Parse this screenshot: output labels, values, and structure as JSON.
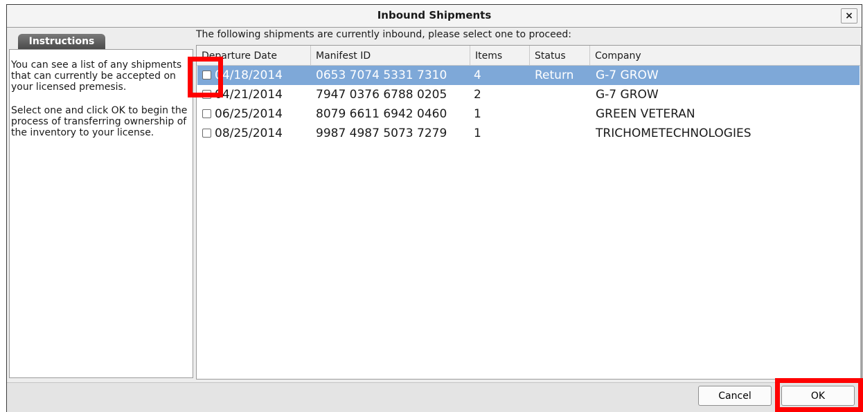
{
  "dialog": {
    "title": "Inbound Shipments",
    "close_label": "×"
  },
  "instructions": {
    "tab_label": "Instructions",
    "para1": "You can see a list of any shipments that can currently be accepted on your licensed premesis.",
    "para2": "Select one and click OK to begin the process of transferring ownership of the inventory to your license."
  },
  "message": "The following shipments are currently inbound, please select one to proceed:",
  "table": {
    "columns": [
      "Departure Date",
      "Manifest ID",
      "Items",
      "Status",
      "Company"
    ],
    "rows": [
      {
        "date": "04/18/2014",
        "manifest": "0653 7074 5331 7310",
        "items": "4",
        "status": "Return",
        "company": "G-7 GROW",
        "selected": true,
        "checked": false
      },
      {
        "date": "04/21/2014",
        "manifest": "7947 0376 6788 0205",
        "items": "2",
        "status": "",
        "company": "G-7 GROW",
        "selected": false,
        "checked": false
      },
      {
        "date": "06/25/2014",
        "manifest": "8079 6611 6942 0460",
        "items": "1",
        "status": "",
        "company": "GREEN VETERAN",
        "selected": false,
        "checked": false
      },
      {
        "date": "08/25/2014",
        "manifest": "9987 4987 5073 7279",
        "items": "1",
        "status": "",
        "company": "TRICHOMETECHNOLOGIES",
        "selected": false,
        "checked": false
      }
    ]
  },
  "buttons": {
    "cancel": "Cancel",
    "ok": "OK"
  },
  "colors": {
    "selection": "#7ea8d8",
    "highlight": "#ff0000"
  }
}
